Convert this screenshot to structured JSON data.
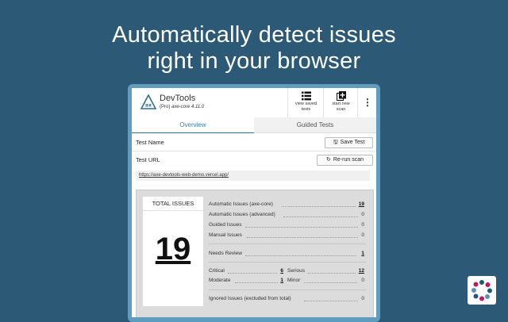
{
  "headline": {
    "line1": "Automatically detect issues",
    "line2": "right in your browser"
  },
  "colors": {
    "background": "#2c5976",
    "frame": "#5e9dbd",
    "accent": "#2e6f99"
  },
  "header": {
    "title": "DevTools",
    "subtitle_prefix": "(Pro) ",
    "subtitle_version": "axe-core 4.11.0",
    "view_saved": {
      "line1": "view saved",
      "line2": "tests",
      "icon": "list-icon"
    },
    "start_new": {
      "line1": "start new",
      "line2": "scan",
      "icon": "add-copy-icon"
    },
    "more_icon": "kebab-icon"
  },
  "tabs": [
    {
      "label": "Overview",
      "active": true
    },
    {
      "label": "Guided Tests",
      "active": false
    }
  ],
  "test_name": {
    "label": "Test Name",
    "button": "Save Test",
    "button_icon": "save-icon"
  },
  "test_url": {
    "label": "Test URL",
    "button": "Re-run scan",
    "button_icon": "refresh-icon",
    "url": "https://axe-devtools-web-demo.vercel.app/"
  },
  "summary": {
    "total_title": "TOTAL ISSUES",
    "total_value": "19",
    "automatic_axe": {
      "label": "Automatic Issues (axe-core)",
      "value": "19"
    },
    "automatic_advanced": {
      "label": "Automatic Issues (advanced)",
      "value": "0"
    },
    "guided": {
      "label": "Guided Issues",
      "value": "0"
    },
    "manual": {
      "label": "Manual Issues",
      "value": "0"
    },
    "needs_review": {
      "label": "Needs Review",
      "value": "1"
    },
    "critical": {
      "label": "Critical",
      "value": "6"
    },
    "serious": {
      "label": "Serious",
      "value": "12"
    },
    "moderate": {
      "label": "Moderate",
      "value": "1"
    },
    "minor": {
      "label": "Minor",
      "value": "0"
    },
    "ignored": {
      "label": "Ignored Issues (excluded from total)",
      "value": "0"
    }
  }
}
